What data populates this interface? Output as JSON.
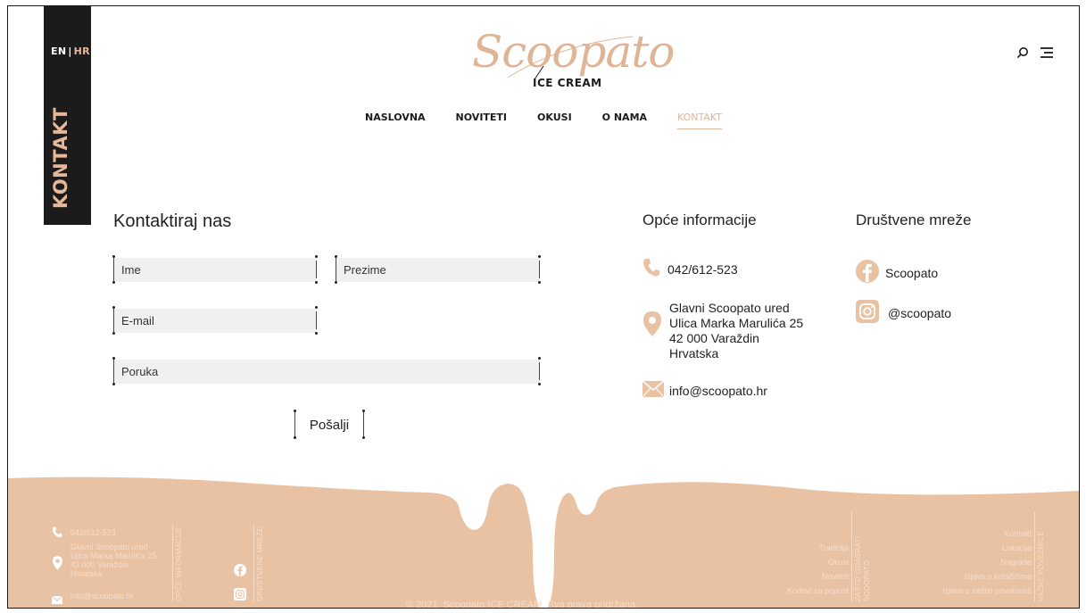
{
  "brand": {
    "script": "Scoopato",
    "subtitle": "ICE CREAM"
  },
  "language": {
    "en": "EN",
    "separator": "|",
    "hr": "HR"
  },
  "side_title": "KONTAKT",
  "nav": {
    "items": [
      "NASLOVNA",
      "NOVITETI",
      "OKUSI",
      "O NAMA",
      "KONTAKT"
    ],
    "active": "KONTAKT"
  },
  "header_icons": {
    "search": "search-icon",
    "menu": "menu-icon"
  },
  "form": {
    "title": "Kontaktiraj nas",
    "name_placeholder": "Ime",
    "surname_placeholder": "Prezime",
    "email_placeholder": "E-mail",
    "message_placeholder": "Poruka",
    "send_label": "Pošalji"
  },
  "general_info": {
    "title": "Opće informacije",
    "phone": "042/612-523",
    "address_lines": [
      "Glavni Scoopato ured",
      "Ulica Marka Marulića 25",
      "42 000 Varaždin",
      "Hrvatska"
    ],
    "email": "info@scoopato.hr"
  },
  "social": {
    "title": "Društvene mreže",
    "facebook": "Scoopato",
    "instagram": "@scoopato"
  },
  "footer": {
    "phone": "042/612-523",
    "address_lines": [
      "Glavni Scoopato ured",
      "Ulica Marka Marulića 25",
      "42 000 Varaždin",
      "Hrvatska"
    ],
    "email": "info@scoopato.hr",
    "label_general": "OPĆE INFORMACIJE",
    "label_social": "DRUŠTVENE MREŽE",
    "why_items": [
      "Tradicija",
      "Okusi",
      "Noviteti",
      "Kodovi za popust"
    ],
    "label_why_1": "ZAŠTO ODABRATI",
    "label_why_2": "SCOOPATO",
    "links": [
      "Kontakt",
      "Lokacija",
      "Nagrade",
      "Izjava o kolačićima",
      "Izjava o zaštiti privatnosti"
    ],
    "label_links": "VAŽNE POVEZNICE",
    "copyright": "© 2021. Scoopato ICE CREAM. Sva prava pridržana."
  },
  "colors": {
    "accent": "#e0b597",
    "footer_bg": "#e9c2a4",
    "dark": "#1b1b1b"
  }
}
